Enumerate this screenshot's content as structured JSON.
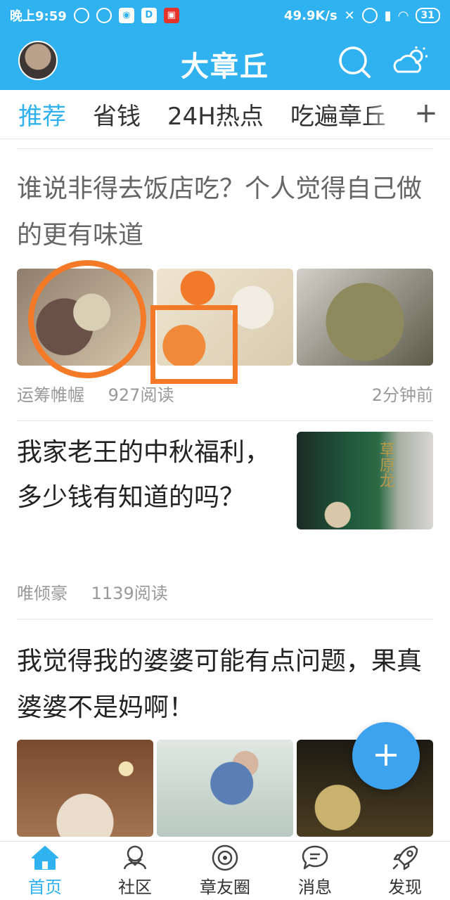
{
  "status_bar": {
    "time": "晚上9:59",
    "speed": "49.9K/s",
    "battery": "31"
  },
  "header": {
    "title": "大章丘"
  },
  "tabs": [
    "推荐",
    "省钱",
    "24H热点",
    "吃遍章丘"
  ],
  "articles": [
    {
      "title": "谁说非得去饭店吃？个人觉得自己做的更有味道",
      "author": "运筹帷幄",
      "reads": "927阅读",
      "time": "2分钟前"
    },
    {
      "title": "我家老王的中秋福利，多少钱有知道的吗？",
      "author": "唯倾豪",
      "reads": "1139阅读",
      "image_text": "草原龙"
    },
    {
      "title": "我觉得我的婆婆可能有点问题，果真婆婆不是妈啊！"
    }
  ],
  "fab": {
    "label": "+"
  },
  "bottom_nav": [
    {
      "label": "首页",
      "icon": "home-icon"
    },
    {
      "label": "社区",
      "icon": "community-icon"
    },
    {
      "label": "章友圈",
      "icon": "circle-icon"
    },
    {
      "label": "消息",
      "icon": "message-icon"
    },
    {
      "label": "发现",
      "icon": "rocket-icon"
    }
  ],
  "colors": {
    "brand": "#2fb2ef",
    "annotation": "#f47a28",
    "fab": "#3ea3ef"
  }
}
